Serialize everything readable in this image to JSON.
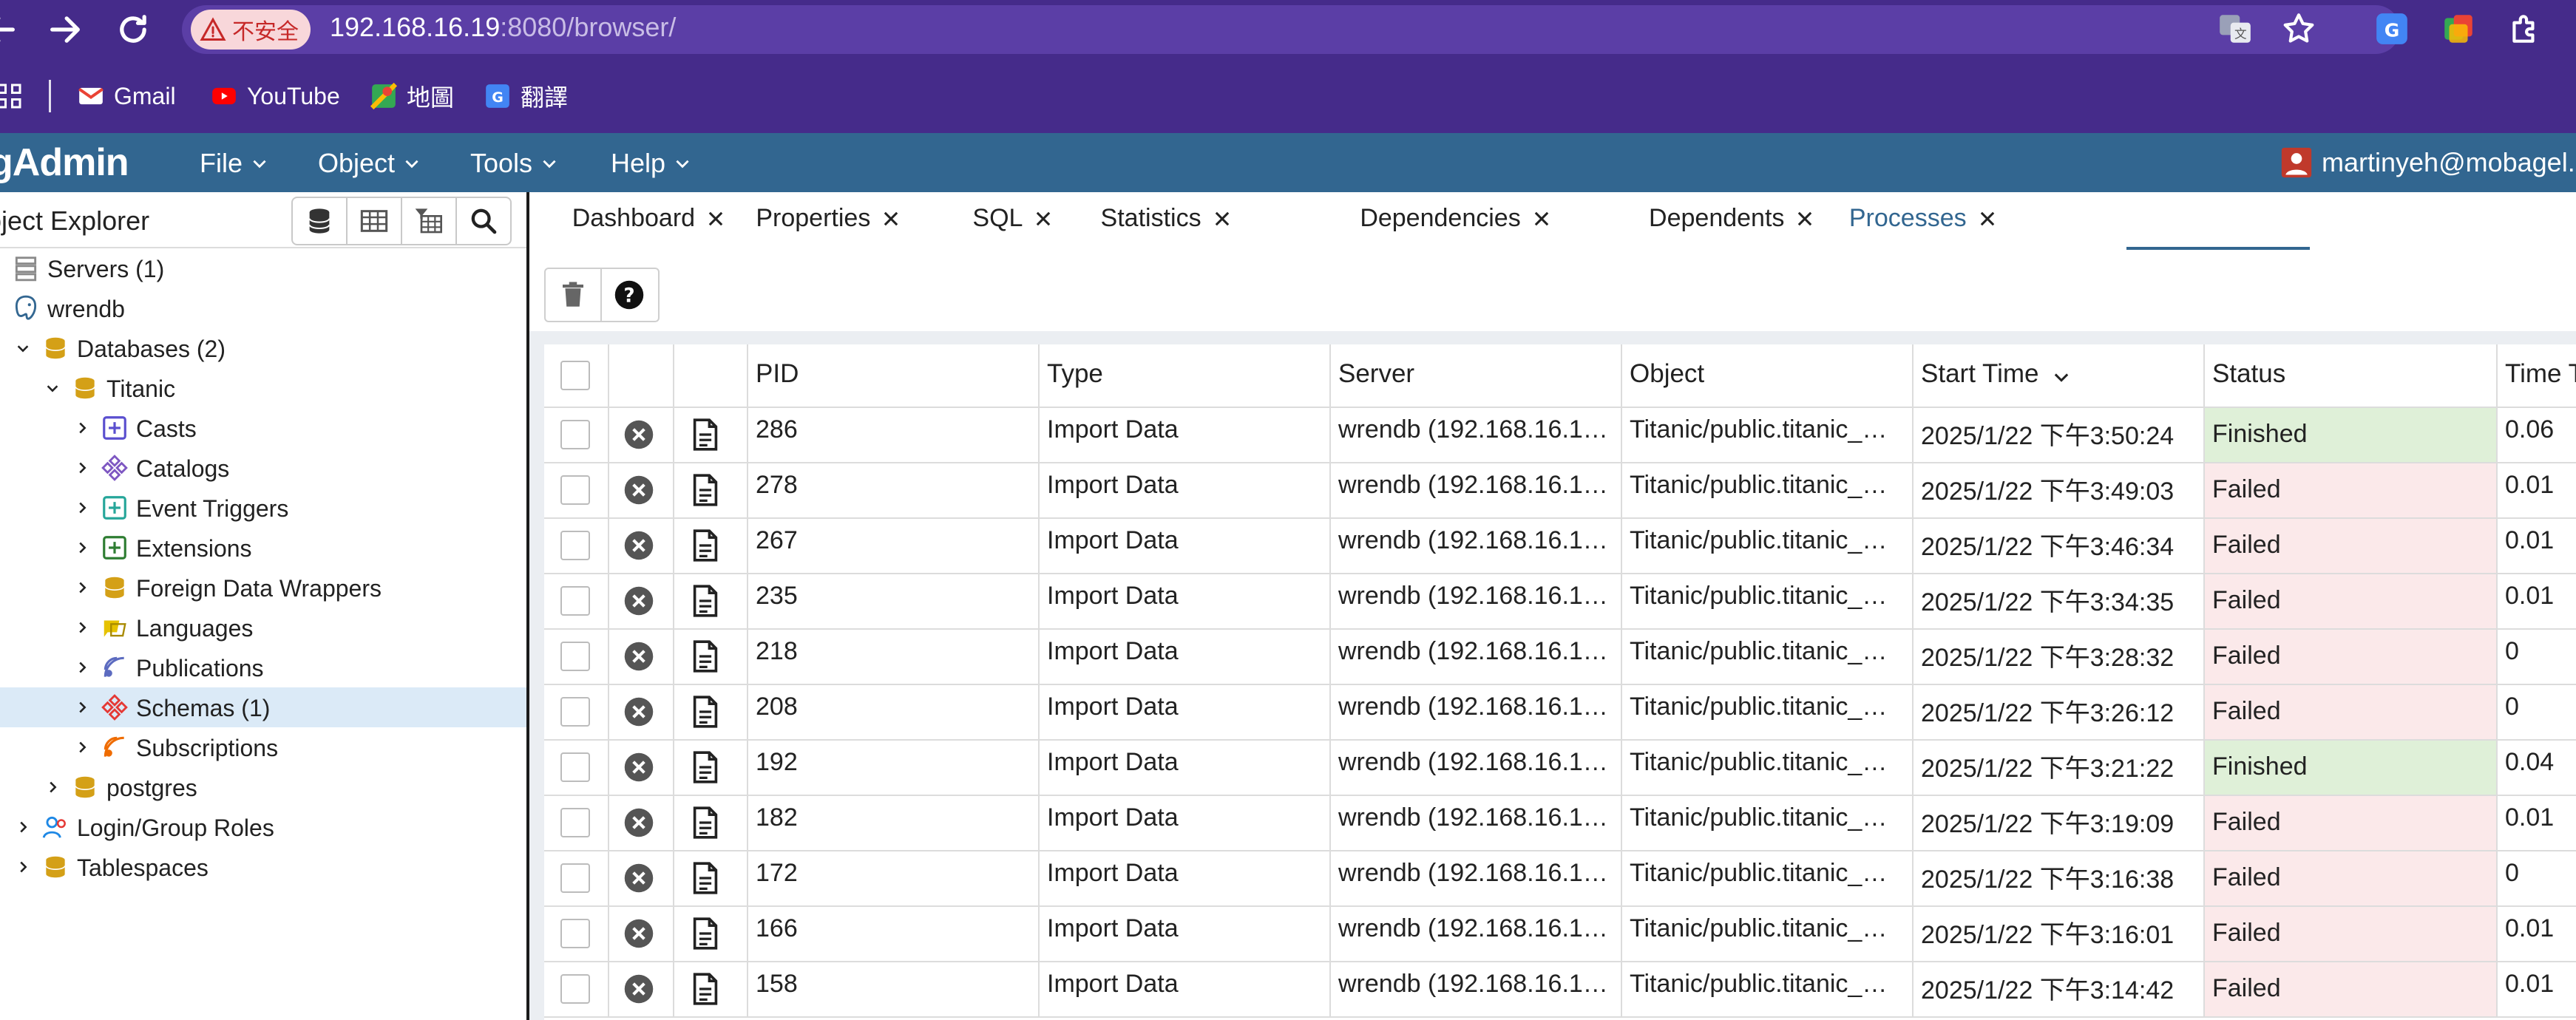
{
  "browser": {
    "security_label": "不安全",
    "url_host": "192.168.16.19",
    "url_rest": ":8080/browser/"
  },
  "bookmarks": [
    {
      "label": "Gmail",
      "icon": "gmail-icon"
    },
    {
      "label": "YouTube",
      "icon": "youtube-icon"
    },
    {
      "label": "地圖",
      "icon": "maps-icon"
    },
    {
      "label": "翻譯",
      "icon": "translate-icon"
    }
  ],
  "app": {
    "logo_text": "gAdmin",
    "menus": [
      "File",
      "Object",
      "Tools",
      "Help"
    ],
    "user": "martinyeh@mobagel.c"
  },
  "explorer": {
    "title": "bject Explorer",
    "tree": [
      {
        "label": "Servers (1)",
        "icon": "servers-icon",
        "chevron": "",
        "level": 0
      },
      {
        "label": "wrendb",
        "icon": "postgres-server-icon",
        "chevron": "down",
        "level": 0
      },
      {
        "label": "Databases (2)",
        "icon": "databases-icon",
        "chevron": "down",
        "level": 1
      },
      {
        "label": "Titanic",
        "icon": "database-icon",
        "chevron": "down",
        "level": 2
      },
      {
        "label": "Casts",
        "icon": "casts-icon",
        "chevron": "right",
        "level": 3
      },
      {
        "label": "Catalogs",
        "icon": "catalogs-icon",
        "chevron": "right",
        "level": 3
      },
      {
        "label": "Event Triggers",
        "icon": "event-triggers-icon",
        "chevron": "right",
        "level": 3
      },
      {
        "label": "Extensions",
        "icon": "extensions-icon",
        "chevron": "right",
        "level": 3
      },
      {
        "label": "Foreign Data Wrappers",
        "icon": "foreign-data-wrappers-icon",
        "chevron": "right",
        "level": 3
      },
      {
        "label": "Languages",
        "icon": "languages-icon",
        "chevron": "right",
        "level": 3
      },
      {
        "label": "Publications",
        "icon": "publications-icon",
        "chevron": "right",
        "level": 3
      },
      {
        "label": "Schemas (1)",
        "icon": "schemas-icon",
        "chevron": "right",
        "level": 3,
        "selected": true
      },
      {
        "label": "Subscriptions",
        "icon": "subscriptions-icon",
        "chevron": "right",
        "level": 3
      },
      {
        "label": "postgres",
        "icon": "database-icon",
        "chevron": "right",
        "level": 2
      },
      {
        "label": "Login/Group Roles",
        "icon": "login-roles-icon",
        "chevron": "right",
        "level": 1
      },
      {
        "label": "Tablespaces",
        "icon": "tablespaces-icon",
        "chevron": "right",
        "level": 1
      }
    ]
  },
  "tabs": [
    {
      "label": "Dashboard"
    },
    {
      "label": "Properties"
    },
    {
      "label": "SQL"
    },
    {
      "label": "Statistics"
    },
    {
      "label": "Dependencies"
    },
    {
      "label": "Dependents"
    },
    {
      "label": "Processes",
      "active": true
    }
  ],
  "search": {
    "placeholder": "Search"
  },
  "table": {
    "columns": [
      "PID",
      "Type",
      "Server",
      "Object",
      "Start Time",
      "Status",
      "Time T"
    ],
    "rows": [
      {
        "pid": "286",
        "type": "Import Data",
        "server": "wrendb (192.168.16.1…",
        "object": "Titanic/public.titanic_…",
        "start": "2025/1/22 下午3:50:24",
        "status": "Finished",
        "time": "0.06"
      },
      {
        "pid": "278",
        "type": "Import Data",
        "server": "wrendb (192.168.16.1…",
        "object": "Titanic/public.titanic_…",
        "start": "2025/1/22 下午3:49:03",
        "status": "Failed",
        "time": "0.01"
      },
      {
        "pid": "267",
        "type": "Import Data",
        "server": "wrendb (192.168.16.1…",
        "object": "Titanic/public.titanic_…",
        "start": "2025/1/22 下午3:46:34",
        "status": "Failed",
        "time": "0.01"
      },
      {
        "pid": "235",
        "type": "Import Data",
        "server": "wrendb (192.168.16.1…",
        "object": "Titanic/public.titanic_…",
        "start": "2025/1/22 下午3:34:35",
        "status": "Failed",
        "time": "0.01"
      },
      {
        "pid": "218",
        "type": "Import Data",
        "server": "wrendb (192.168.16.1…",
        "object": "Titanic/public.titanic_…",
        "start": "2025/1/22 下午3:28:32",
        "status": "Failed",
        "time": "0"
      },
      {
        "pid": "208",
        "type": "Import Data",
        "server": "wrendb (192.168.16.1…",
        "object": "Titanic/public.titanic_…",
        "start": "2025/1/22 下午3:26:12",
        "status": "Failed",
        "time": "0"
      },
      {
        "pid": "192",
        "type": "Import Data",
        "server": "wrendb (192.168.16.1…",
        "object": "Titanic/public.titanic_…",
        "start": "2025/1/22 下午3:21:22",
        "status": "Finished",
        "time": "0.04"
      },
      {
        "pid": "182",
        "type": "Import Data",
        "server": "wrendb (192.168.16.1…",
        "object": "Titanic/public.titanic_…",
        "start": "2025/1/22 下午3:19:09",
        "status": "Failed",
        "time": "0.01"
      },
      {
        "pid": "172",
        "type": "Import Data",
        "server": "wrendb (192.168.16.1…",
        "object": "Titanic/public.titanic_…",
        "start": "2025/1/22 下午3:16:38",
        "status": "Failed",
        "time": "0"
      },
      {
        "pid": "166",
        "type": "Import Data",
        "server": "wrendb (192.168.16.1…",
        "object": "Titanic/public.titanic_…",
        "start": "2025/1/22 下午3:16:01",
        "status": "Failed",
        "time": "0.01"
      },
      {
        "pid": "158",
        "type": "Import Data",
        "server": "wrendb (192.168.16.1…",
        "object": "Titanic/public.titanic_…",
        "start": "2025/1/22 下午3:14:42",
        "status": "Failed",
        "time": "0.01"
      }
    ]
  },
  "colors": {
    "browser_bar": "#452b8a",
    "pg_header": "#326690",
    "finished_bg": "#dff0d8",
    "failed_bg": "#fbe9ea",
    "selected_row": "#dbeaf7"
  }
}
